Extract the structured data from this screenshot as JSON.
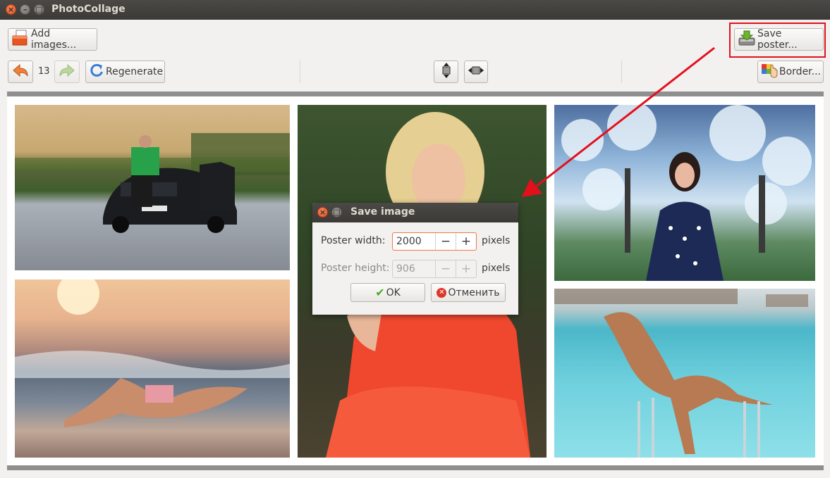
{
  "window": {
    "title": "PhotoCollage"
  },
  "toolbar": {
    "add_images_label": "Add images...",
    "save_poster_label": "Save poster...",
    "history_count": "13",
    "regenerate_label": "Regenerate",
    "border_label": "Border..."
  },
  "dialog": {
    "title": "Save image",
    "width_label": "Poster width:",
    "width_value": "2000",
    "height_label": "Poster height:",
    "height_value": "906",
    "unit": "pixels",
    "minus": "−",
    "plus": "+",
    "ok_label": "OK",
    "cancel_label": "Отменить"
  },
  "colors": {
    "accent": "#e3101c",
    "titlebar": "#3b3a36",
    "close": "#e2501f"
  }
}
